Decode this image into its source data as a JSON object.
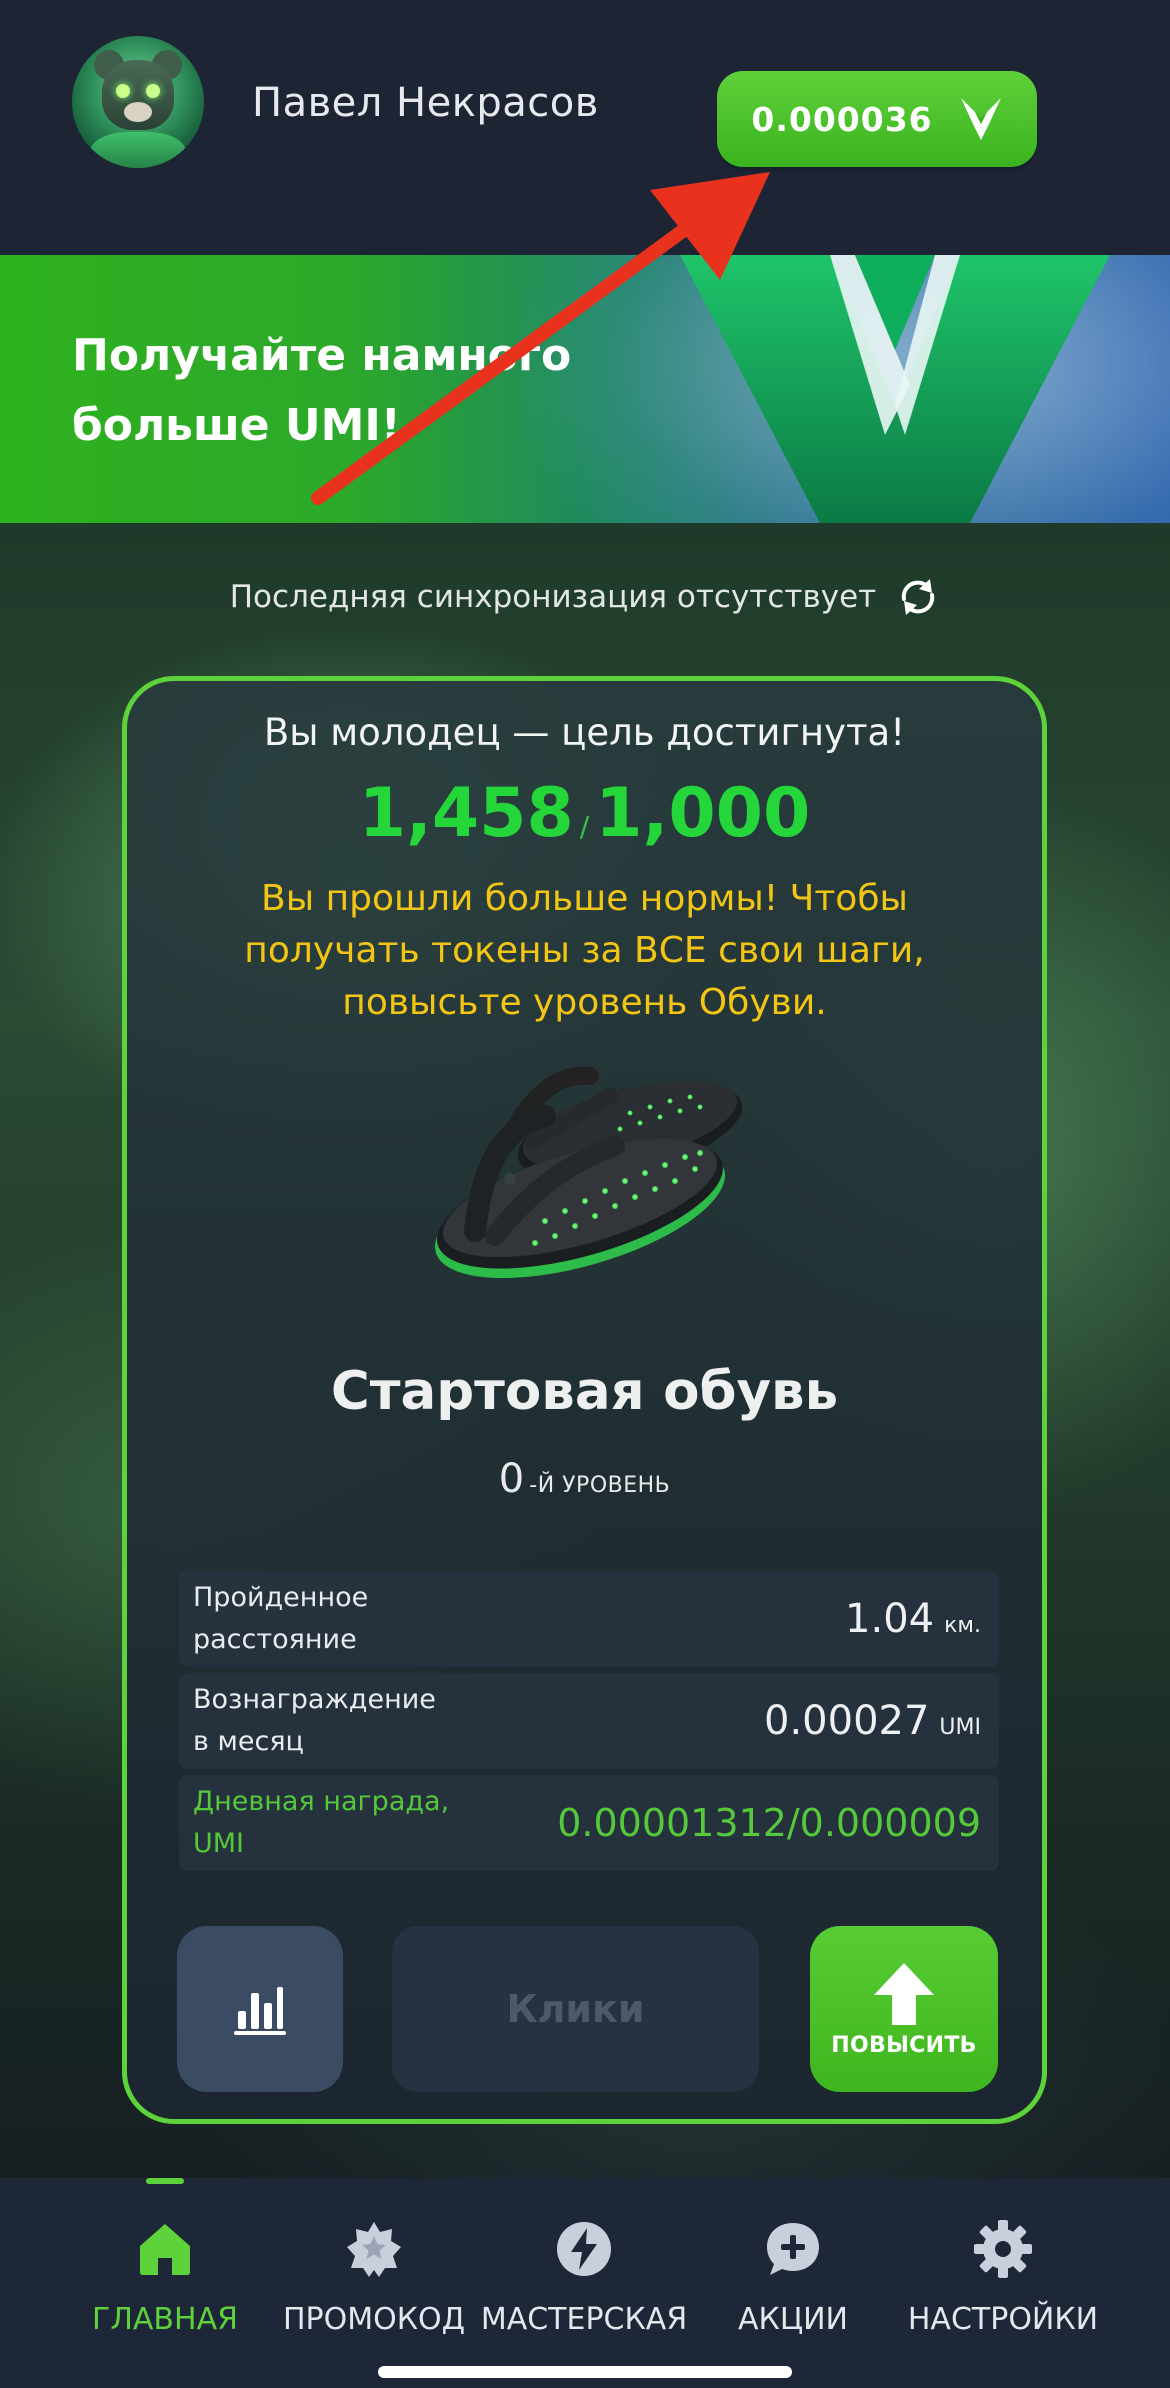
{
  "header": {
    "user_name": "Павел Некрасов",
    "balance": "0.000036"
  },
  "banner": {
    "title": "Получайте намного больше UMI!"
  },
  "sync": {
    "text": "Последняя синхронизация отсутствует",
    "icon": "refresh-icon"
  },
  "card": {
    "heading": "Вы молодец — цель достигнута!",
    "steps_done": "1,458",
    "steps_separator": "/",
    "steps_goal": "1,000",
    "warning": "Вы прошли больше нормы! Чтобы получать токены за ВСЕ свои шаги, повысьте уровень Обуви.",
    "shoe_name": "Стартовая обувь",
    "level_number": "0",
    "level_label": "-Й УРОВЕНЬ",
    "stats": [
      {
        "label": "Пройденное расстояние",
        "value": "1.04",
        "unit": "км."
      },
      {
        "label": "Вознаграждение в месяц",
        "value": "0.00027",
        "unit": "UMI"
      },
      {
        "label": "Дневная награда, UMI",
        "value": "0.00001312/0.000009",
        "unit": ""
      }
    ],
    "buttons": {
      "stats_icon": "bar-chart-icon",
      "clicks_label": "Клики",
      "upgrade_label": "ПОВЫСИТЬ"
    }
  },
  "nav": {
    "items": [
      {
        "label": "ГЛАВНАЯ",
        "icon": "home-icon",
        "active": true
      },
      {
        "label": "ПРОМОКОД",
        "icon": "star-badge-icon",
        "active": false
      },
      {
        "label": "МАСТЕРСКАЯ",
        "icon": "lightning-icon",
        "active": false
      },
      {
        "label": "АКЦИИ",
        "icon": "chat-plus-icon",
        "active": false
      },
      {
        "label": "НАСТРОЙКИ",
        "icon": "gear-icon",
        "active": false
      }
    ]
  },
  "colors": {
    "accent_green": "#5dd23b",
    "steps_green": "#25d63a",
    "warning_yellow": "#f3c514",
    "background": "#1d2535",
    "arrow_red": "#e8321e"
  }
}
